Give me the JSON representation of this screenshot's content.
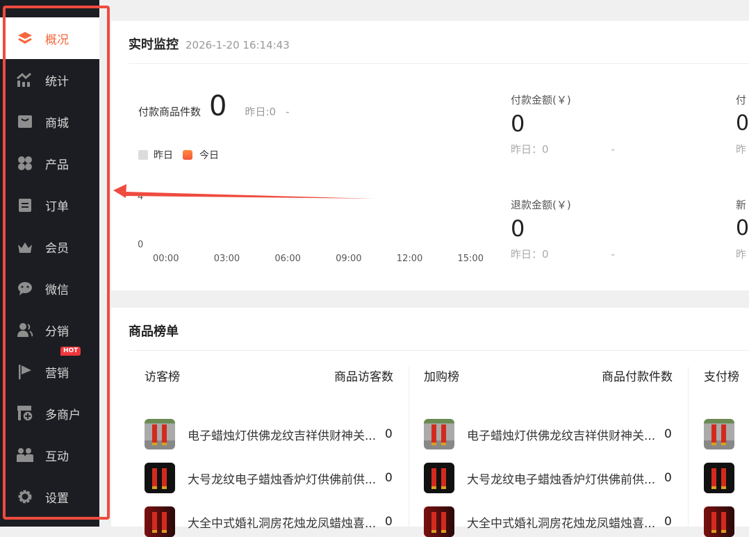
{
  "sidebar": {
    "items": [
      {
        "label": "概况",
        "icon": "layers-icon",
        "active": true
      },
      {
        "label": "统计",
        "icon": "chart-icon"
      },
      {
        "label": "商城",
        "icon": "bag-icon"
      },
      {
        "label": "产品",
        "icon": "grid-icon"
      },
      {
        "label": "订单",
        "icon": "clipboard-icon"
      },
      {
        "label": "会员",
        "icon": "crown-icon"
      },
      {
        "label": "微信",
        "icon": "wechat-icon"
      },
      {
        "label": "分销",
        "icon": "users-icon"
      },
      {
        "label": "营销",
        "icon": "flag-icon",
        "badge": "HOT"
      },
      {
        "label": "多商户",
        "icon": "store-icon"
      },
      {
        "label": "互动",
        "icon": "people-icon"
      },
      {
        "label": "设置",
        "icon": "gear-icon"
      }
    ]
  },
  "monitor": {
    "title": "实时监控",
    "time": "2026-1-20 16:14:43",
    "main": {
      "label": "付款商品件数",
      "value": "0",
      "yesterday": "昨日:0",
      "trend": "-"
    },
    "legend": [
      "昨日",
      "今日"
    ],
    "chart_data": {
      "type": "line",
      "x": [
        "00:00",
        "03:00",
        "06:00",
        "09:00",
        "12:00",
        "15:00"
      ],
      "y_ticks": [
        "4",
        "0"
      ],
      "series": [
        {
          "name": "昨日",
          "values": []
        },
        {
          "name": "今日",
          "values": []
        }
      ]
    },
    "metrics": [
      {
        "label": "付款金额(￥)",
        "value": "0",
        "yesterday": "昨日：0",
        "trend": "-"
      },
      {
        "label": "付",
        "value": "0",
        "yesterday": "昨"
      },
      {
        "label": "退款金额(￥)",
        "value": "0",
        "yesterday": "昨日：0",
        "trend": "-"
      },
      {
        "label": "新",
        "value": "0",
        "yesterday": "昨"
      }
    ]
  },
  "ranking": {
    "title": "商品榜单",
    "columns": [
      {
        "title": "访客榜",
        "metric": "商品访客数"
      },
      {
        "title": "加购榜",
        "metric": "商品付款件数"
      },
      {
        "title": "支付榜",
        "metric": ""
      }
    ],
    "products": [
      {
        "name": "电子蜡烛灯供佛龙纹吉祥供财神关...",
        "value": "0"
      },
      {
        "name": "大号龙纹电子蜡烛香炉灯供佛前供...",
        "value": "0"
      },
      {
        "name": "大全中式婚礼洞房花烛龙凤蜡烛喜...",
        "value": "0"
      }
    ]
  },
  "colors": {
    "accent": "#f5683d",
    "sidebar": "#1c1d22",
    "annotation": "#ef4b3f"
  }
}
